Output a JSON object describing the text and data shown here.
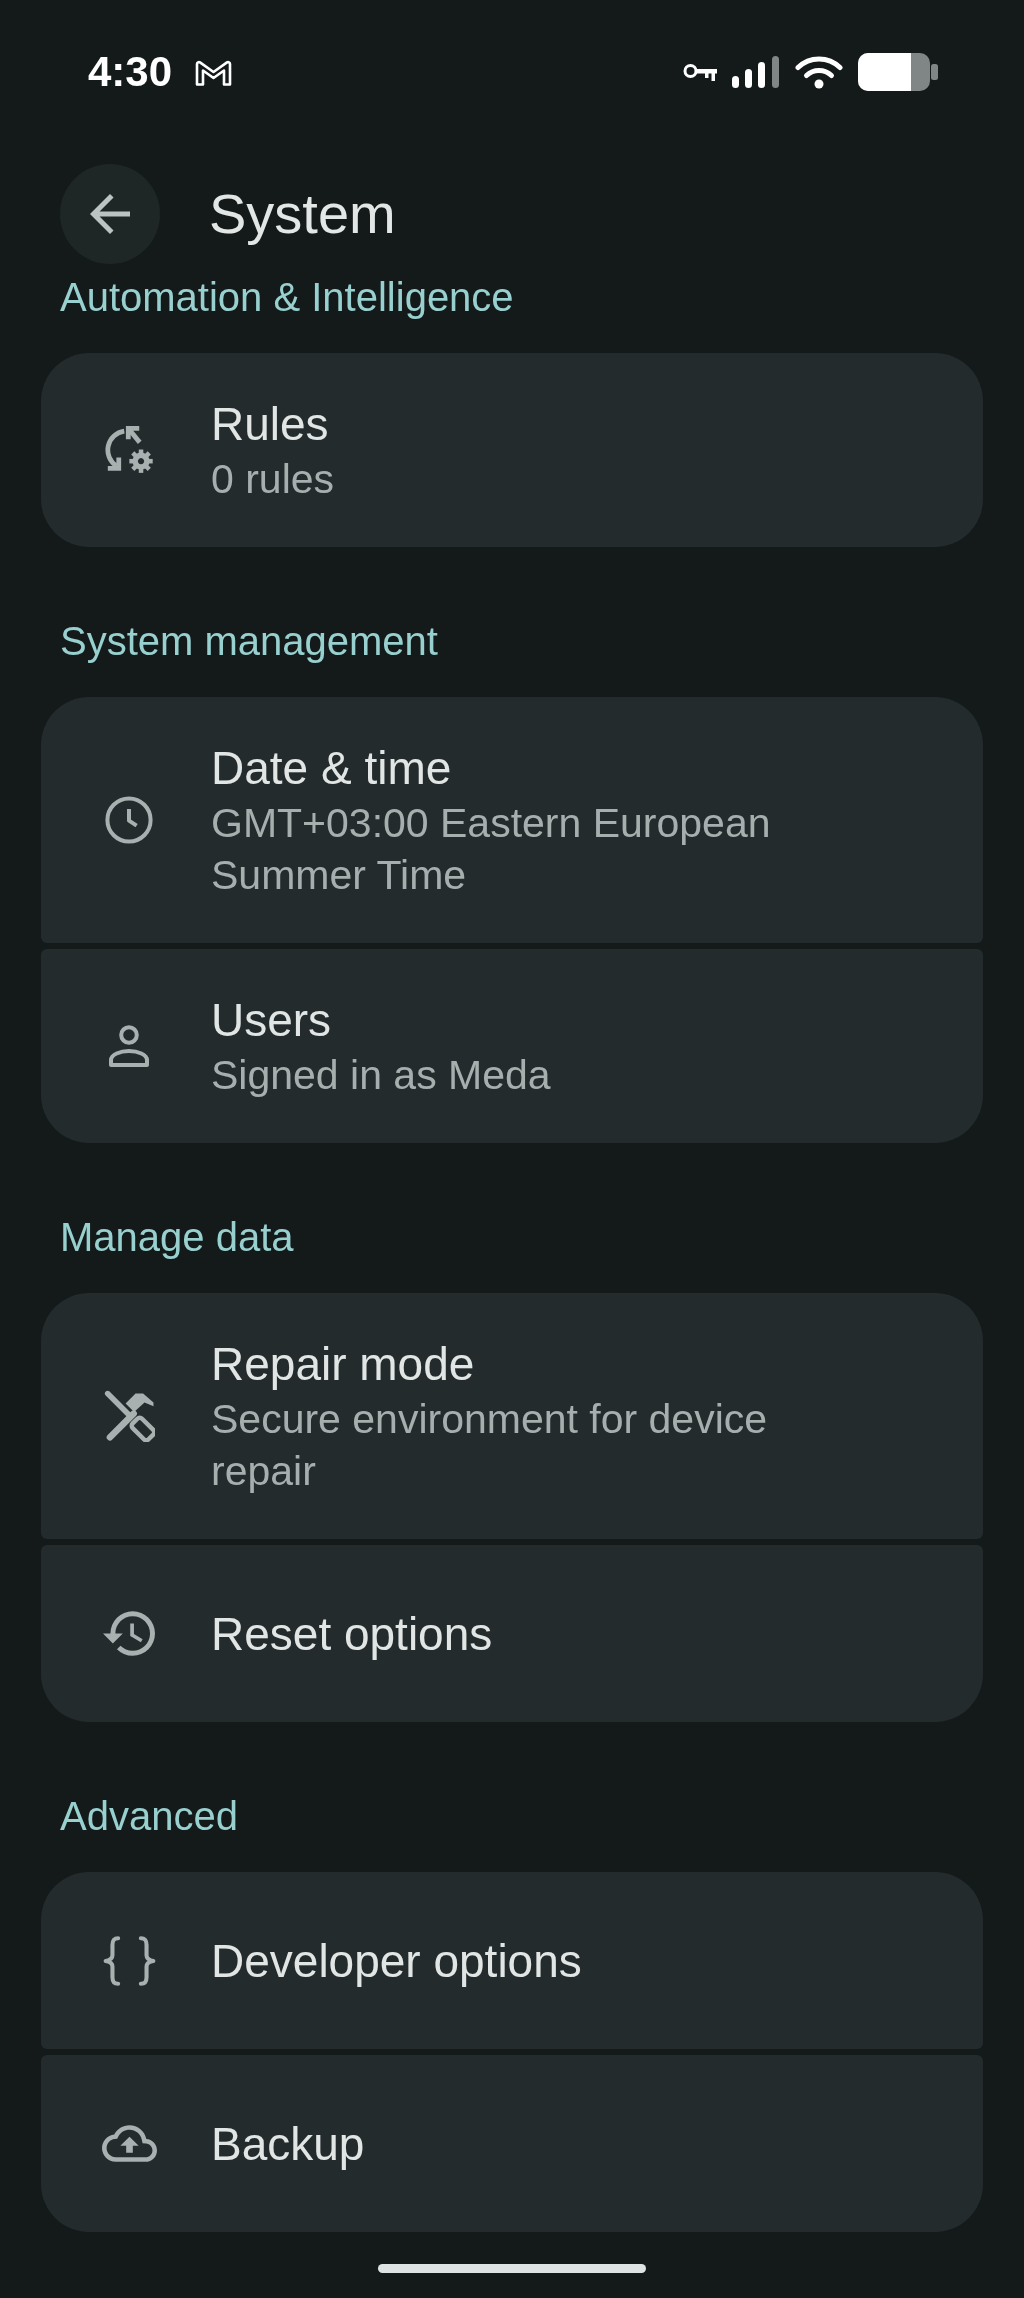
{
  "status_bar": {
    "time": "4:30"
  },
  "header": {
    "title": "System"
  },
  "sections": [
    {
      "title": "Automation & Intelligence",
      "items": [
        {
          "title": "Rules",
          "subtitle": "0 rules"
        }
      ]
    },
    {
      "title": "System management",
      "items": [
        {
          "title": "Date & time",
          "subtitle": "GMT+03:00 Eastern European Summer Time"
        },
        {
          "title": "Users",
          "subtitle": "Signed in as Meda"
        }
      ]
    },
    {
      "title": "Manage data",
      "items": [
        {
          "title": "Repair mode",
          "subtitle": "Secure environment for device repair"
        },
        {
          "title": "Reset options"
        }
      ]
    },
    {
      "title": "Advanced",
      "items": [
        {
          "title": "Developer options"
        },
        {
          "title": "Backup"
        }
      ]
    }
  ]
}
